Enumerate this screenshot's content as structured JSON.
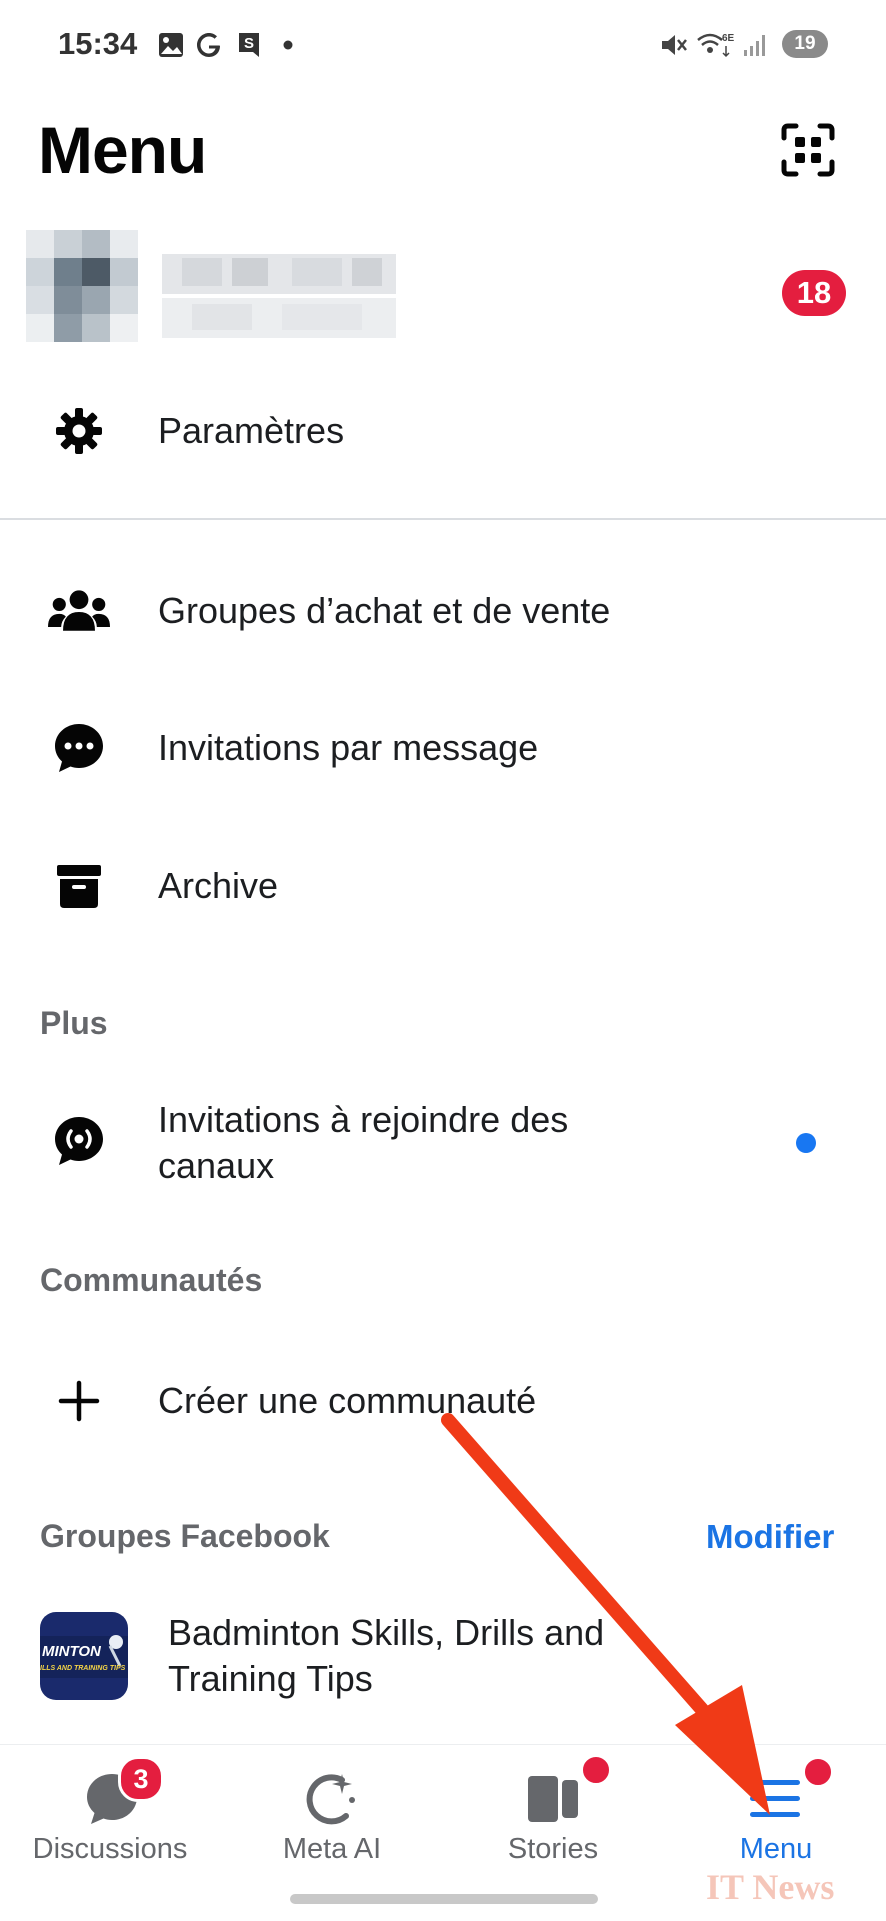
{
  "status_bar": {
    "time": "15:34",
    "left_icons": [
      "image-icon",
      "google-icon",
      "s-app-icon",
      "dot-icon"
    ],
    "right_icons": [
      "mute-icon",
      "wifi-6e-icon",
      "signal-icon"
    ],
    "battery": "19"
  },
  "header": {
    "title": "Menu",
    "qr_icon": "qr-scanner-icon"
  },
  "profile": {
    "notification_count": "18"
  },
  "settings": {
    "label": "Paramètres",
    "icon": "gear-icon"
  },
  "menu_items": [
    {
      "label": "Groupes d’achat et de vente",
      "icon": "group-icon"
    },
    {
      "label": "Invitations par message",
      "icon": "chat-bubble-icon"
    },
    {
      "label": "Archive",
      "icon": "archive-icon"
    }
  ],
  "sections": {
    "plus": "Plus",
    "communities": "Communautés",
    "fb_groups": "Groupes Facebook",
    "edit": "Modifier"
  },
  "channel_invites": {
    "line1": "Invitations à rejoindre des",
    "line2": "canaux",
    "icon": "broadcast-icon",
    "unread_color": "#1877f2"
  },
  "create_community": {
    "label": "Créer une communauté",
    "icon": "plus-icon"
  },
  "group": {
    "line1": "Badminton Skills, Drills and",
    "line2": "Training Tips",
    "thumb_text_1": "MINTON",
    "thumb_text_2": "ILLS AND TRAINING TIPS"
  },
  "bottom_nav": [
    {
      "label": "Discussions",
      "icon": "chat-icon",
      "badge": "3"
    },
    {
      "label": "Meta AI",
      "icon": "meta-ai-icon"
    },
    {
      "label": "Stories",
      "icon": "stories-icon",
      "dot": true
    },
    {
      "label": "Menu",
      "icon": "hamburger-icon",
      "dot": true,
      "active": true
    }
  ],
  "colors": {
    "accent": "#1b74e4",
    "badge": "#e41e3f",
    "annotation_arrow": "#f03a17"
  },
  "watermark": "IT News"
}
